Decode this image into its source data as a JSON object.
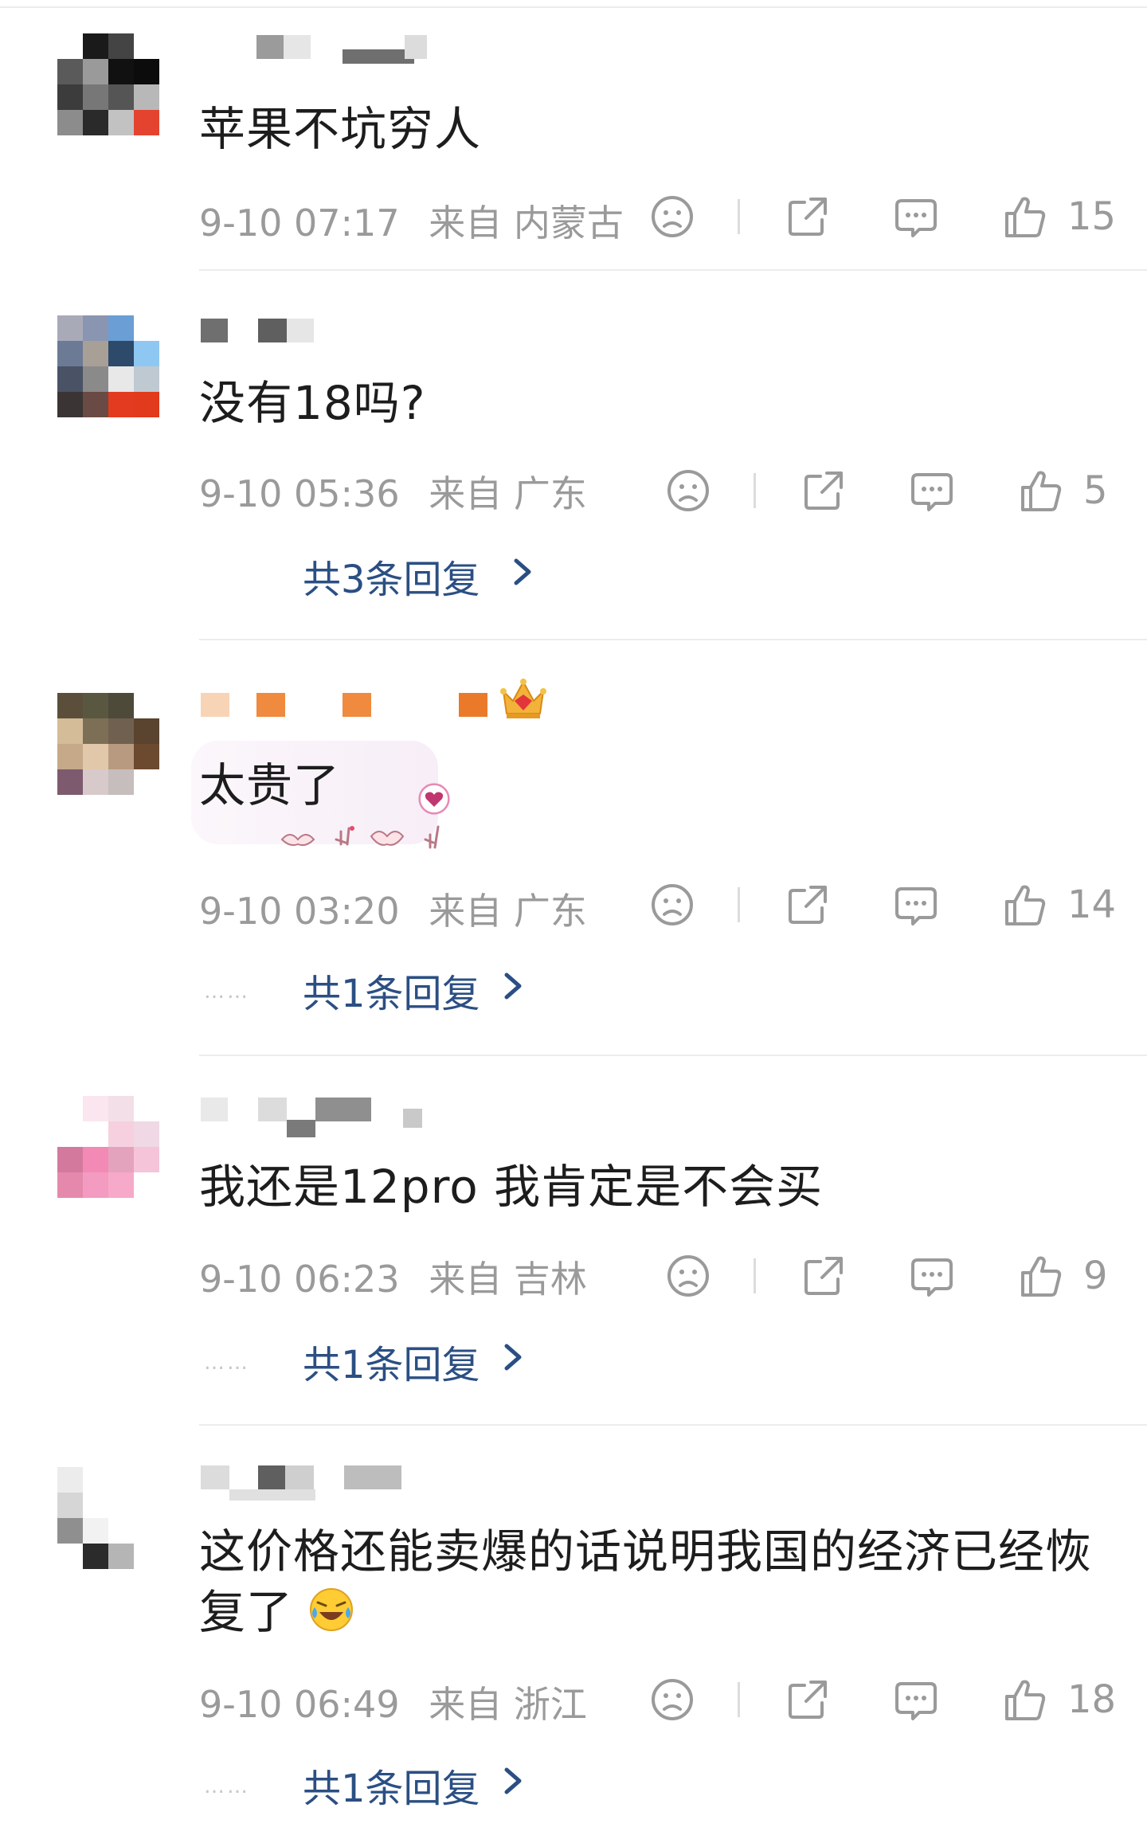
{
  "comments": [
    {
      "text": "苹果不坑穷人",
      "time": "9-10 07:17",
      "from": "来自",
      "location": "内蒙古",
      "likes": "15",
      "replies": ""
    },
    {
      "text": "没有18吗?",
      "time": "9-10 05:36",
      "from": "来自",
      "location": "广东",
      "likes": "5",
      "replies": "共3条回复"
    },
    {
      "text": "太贵了",
      "time": "9-10 03:20",
      "from": "来自",
      "location": "广东",
      "likes": "14",
      "replies": "共1条回复"
    },
    {
      "text": "我还是12pro  我肯定是不会买",
      "time": "9-10 06:23",
      "from": "来自",
      "location": "吉林",
      "likes": "9",
      "replies": "共1条回复"
    },
    {
      "text_line1": "这价格还能卖爆的话说明我国的经济已经恢",
      "text_line2": "复了",
      "time": "9-10 06:49",
      "from": "来自",
      "location": "浙江",
      "likes": "18",
      "replies": "共1条回复"
    }
  ],
  "reply_dots": "……",
  "colors": {
    "link": "#2b4f83",
    "meta": "#9a9a9a",
    "text": "#1d1d1d",
    "divider": "#ececec"
  },
  "icons": [
    "dislike-face-icon",
    "share-icon",
    "comment-icon",
    "thumbs-up-icon",
    "chevron-right-icon",
    "crown-badge-icon",
    "tears-of-joy-emoji"
  ]
}
